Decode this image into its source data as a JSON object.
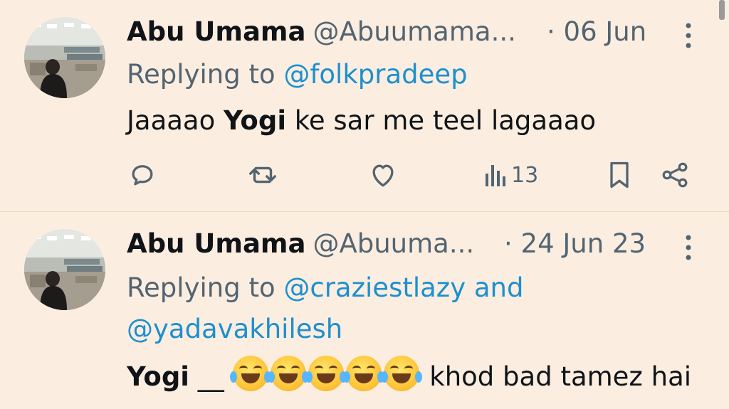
{
  "tweets": [
    {
      "author_name": "Abu Umama",
      "handle": "@Abuumama...",
      "date": "· 06 Jun",
      "replying_prefix": "Replying to",
      "replying_to": "@folkpradeep",
      "body_bold": "Yogi",
      "body_before": "Jaaaao",
      "body_after": "ke sar me teel lagaaao",
      "views": "13"
    },
    {
      "author_name": "Abu Umama",
      "handle": "@Abuuma...",
      "date": "· 24 Jun 23",
      "replying_prefix": "Replying to",
      "replying_to_1": "@craziestlazy and",
      "replying_to_2": "@yadavakhilesh",
      "body_bold": "Yogi",
      "body_mid": "__",
      "body_after": "khod bad tamez hai",
      "emoji_icon": "face-with-tears-of-joy-icon"
    }
  ],
  "colors": {
    "background": "#fbeee1",
    "mention": "#1d8fcf",
    "secondary_text": "#536471"
  }
}
